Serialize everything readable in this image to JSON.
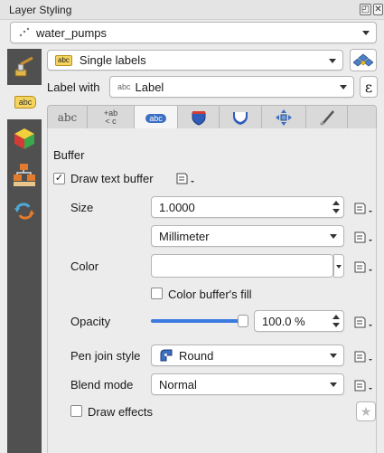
{
  "window": {
    "title": "Layer Styling",
    "restore_glyph": "◰",
    "close_glyph": "✕"
  },
  "layer_select": {
    "value": "water_pumps"
  },
  "renderer": {
    "value": "Single labels",
    "badge": "abc"
  },
  "label_with": {
    "label": "Label with",
    "prefix": "abc",
    "value": "Label",
    "expr_glyph": "ε"
  },
  "tabs": [
    {
      "name": "text",
      "text": "abc"
    },
    {
      "name": "formatting",
      "top": "+ab",
      "bottom": "< c"
    },
    {
      "name": "buffer",
      "text": "abc"
    },
    {
      "name": "background",
      "icon": "shield-icon"
    },
    {
      "name": "shadow",
      "icon": "shadow-icon"
    },
    {
      "name": "placement",
      "icon": "placement-icon"
    },
    {
      "name": "rendering",
      "icon": "brush-icon"
    }
  ],
  "sidebar": {
    "items": [
      {
        "icon": "paintbrush-icon"
      },
      {
        "icon": "labels-icon",
        "text": "abc"
      },
      {
        "icon": "3d-cube-icon"
      },
      {
        "icon": "diagram-icon"
      },
      {
        "icon": "history-icon"
      }
    ]
  },
  "buffer": {
    "section_title": "Buffer",
    "draw_text_buffer": {
      "label": "Draw text buffer",
      "checked": true,
      "mark": "✓"
    },
    "size": {
      "label": "Size",
      "value": "1.0000"
    },
    "unit": {
      "value": "Millimeter"
    },
    "color": {
      "label": "Color",
      "value": "#ffffff"
    },
    "color_buffer_fill": {
      "label": "Color buffer's fill",
      "checked": false
    },
    "opacity": {
      "label": "Opacity",
      "value": "100.0 %",
      "level": 1.0
    },
    "pen_join": {
      "label": "Pen join style",
      "value": "Round"
    },
    "blend_mode": {
      "label": "Blend mode",
      "value": "Normal"
    },
    "draw_effects": {
      "label": "Draw effects",
      "checked": false
    },
    "effects_glyph": "★"
  }
}
